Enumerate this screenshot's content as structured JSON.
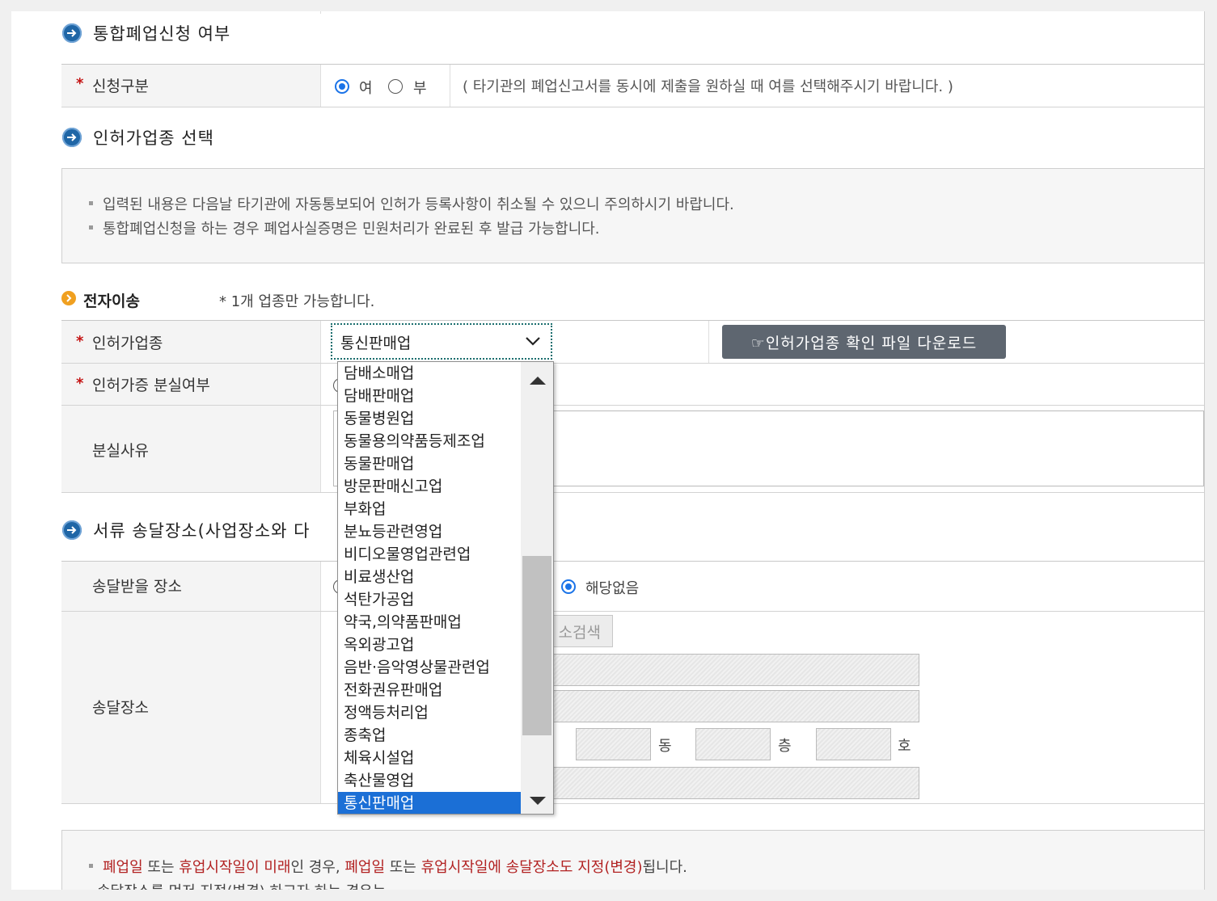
{
  "sections": {
    "integrated": {
      "title": "통합폐업신청 여부",
      "field_label": "신청구분",
      "opt_yes": "여",
      "opt_no": "부",
      "hint": "( 타기관의 폐업신고서를 동시에 제출을 원하실 때 여를 선택해주시기 바랍니다. )",
      "selected": "여"
    },
    "license": {
      "title": "인허가업종 선택",
      "notes": [
        "입력된 내용은 다음날 타기관에 자동통보되어 인허가 등록사항이 취소될 수 있으니 주의하시기 바랍니다.",
        "통합폐업신청을 하는 경우 폐업사실증명은 민원처리가 완료된 후 발급 가능합니다."
      ],
      "subsection": "전자이송",
      "subsection_hint": "* 1개 업종만 가능합니다.",
      "type_label": "인허가업종",
      "select_value": "통신판매업",
      "download_button": "☞인허가업종 확인 파일 다운로드",
      "lost_label": "인허가증 분실여부",
      "reason_label": "분실사유"
    },
    "delivery": {
      "title": "서류 송달장소(사업장소와 다",
      "receive_label": "송달받을 장소",
      "none_option": "해당없음",
      "address_label": "송달장소",
      "search_button": "소검색",
      "dong": "동",
      "floor": "층",
      "ho": "호"
    }
  },
  "dropdown": {
    "options": [
      "담배소매업",
      "담배판매업",
      "동물병원업",
      "동물용의약품등제조업",
      "동물판매업",
      "방문판매신고업",
      "부화업",
      "분뇨등관련영업",
      "비디오물영업관련업",
      "비료생산업",
      "석탄가공업",
      "약국,의약품판매업",
      "옥외광고업",
      "음반·음악영상물관련업",
      "전화권유판매업",
      "정액등처리업",
      "종축업",
      "체육시설업",
      "축산물영업",
      "통신판매업"
    ],
    "selected_index": 19
  },
  "bottom_notes": {
    "line1_parts": [
      {
        "t": "폐업일",
        "red": true
      },
      {
        "t": " 또는 ",
        "red": false
      },
      {
        "t": "휴업시작일이 미래",
        "red": true
      },
      {
        "t": "인 경우, ",
        "red": false
      },
      {
        "t": "폐업일",
        "red": true
      },
      {
        "t": " 또는 ",
        "red": false
      },
      {
        "t": "휴업시작일에 송달장소도 지정(변경)",
        "red": true
      },
      {
        "t": "됩니다.",
        "red": false
      }
    ],
    "line2": "송달장소를 먼저 지정(변경) 하고자 하는 경우는"
  },
  "colors": {
    "accent": "#1f66a6",
    "selection": "#1b6fd6",
    "required": "#c41212",
    "button": "#5e6670"
  }
}
